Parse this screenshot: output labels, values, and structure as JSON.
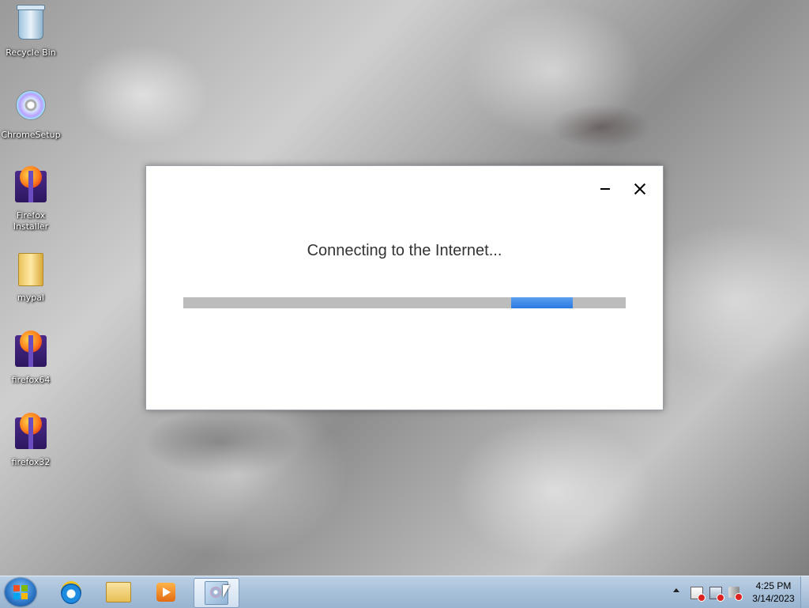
{
  "desktop": {
    "icons": [
      {
        "label": "Recycle Bin",
        "icon": "recycle-bin-icon"
      },
      {
        "label": "ChromeSetup",
        "icon": "installer-disc-icon"
      },
      {
        "label": "Firefox Installer",
        "icon": "firefox-installer-icon"
      },
      {
        "label": "mypal",
        "icon": "folder-icon"
      },
      {
        "label": "firefox64",
        "icon": "firefox-installer-icon"
      },
      {
        "label": "firefox32",
        "icon": "firefox-installer-icon"
      }
    ]
  },
  "dialog": {
    "status_text": "Connecting to the Internet...",
    "progress_state": "indeterminate",
    "colors": {
      "progress_track": "#bcbcbc",
      "progress_fill": "#2a78e0"
    }
  },
  "taskbar": {
    "pinned": [
      {
        "name": "internet-explorer",
        "icon": "internet-explorer-icon"
      },
      {
        "name": "windows-explorer",
        "icon": "folder-icon"
      },
      {
        "name": "media-player",
        "icon": "media-player-icon"
      },
      {
        "name": "setup-window",
        "icon": "installer-icon",
        "active": true
      }
    ],
    "tray": {
      "clock_time": "4:25 PM",
      "clock_date": "3/14/2023"
    }
  }
}
